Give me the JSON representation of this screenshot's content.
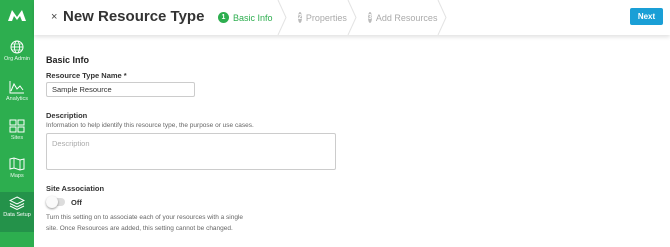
{
  "sidebar": {
    "items": [
      {
        "label": "Org Admin",
        "icon": "globe-icon"
      },
      {
        "label": "Analytics",
        "icon": "chart-line-icon"
      },
      {
        "label": "Sites",
        "icon": "sites-grid-icon"
      },
      {
        "label": "Maps",
        "icon": "map-icon"
      },
      {
        "label": "Data Setup",
        "icon": "layers-icon",
        "active": true
      }
    ]
  },
  "header": {
    "title": "New Resource Type",
    "close_label": "×",
    "steps": [
      {
        "num": "1",
        "label": "Basic Info",
        "active": true
      },
      {
        "num": "2",
        "label": "Properties",
        "active": false
      },
      {
        "num": "3",
        "label": "Add Resources",
        "active": false
      }
    ],
    "next_label": "Next"
  },
  "form": {
    "section_title": "Basic Info",
    "name_label": "Resource Type Name *",
    "name_value": "Sample Resource",
    "description_label": "Description",
    "description_hint": "Information to help identify this resource type, the purpose or use cases.",
    "description_placeholder": "Description",
    "site_label": "Site Association",
    "site_toggle_state": "Off",
    "site_hint_line1": "Turn this setting on to associate each of your resources with a single",
    "site_hint_line2": "site. Once Resources are added, this setting cannot be changed."
  },
  "colors": {
    "brand_green": "#2dae4f",
    "next_blue": "#1a9fd6"
  }
}
